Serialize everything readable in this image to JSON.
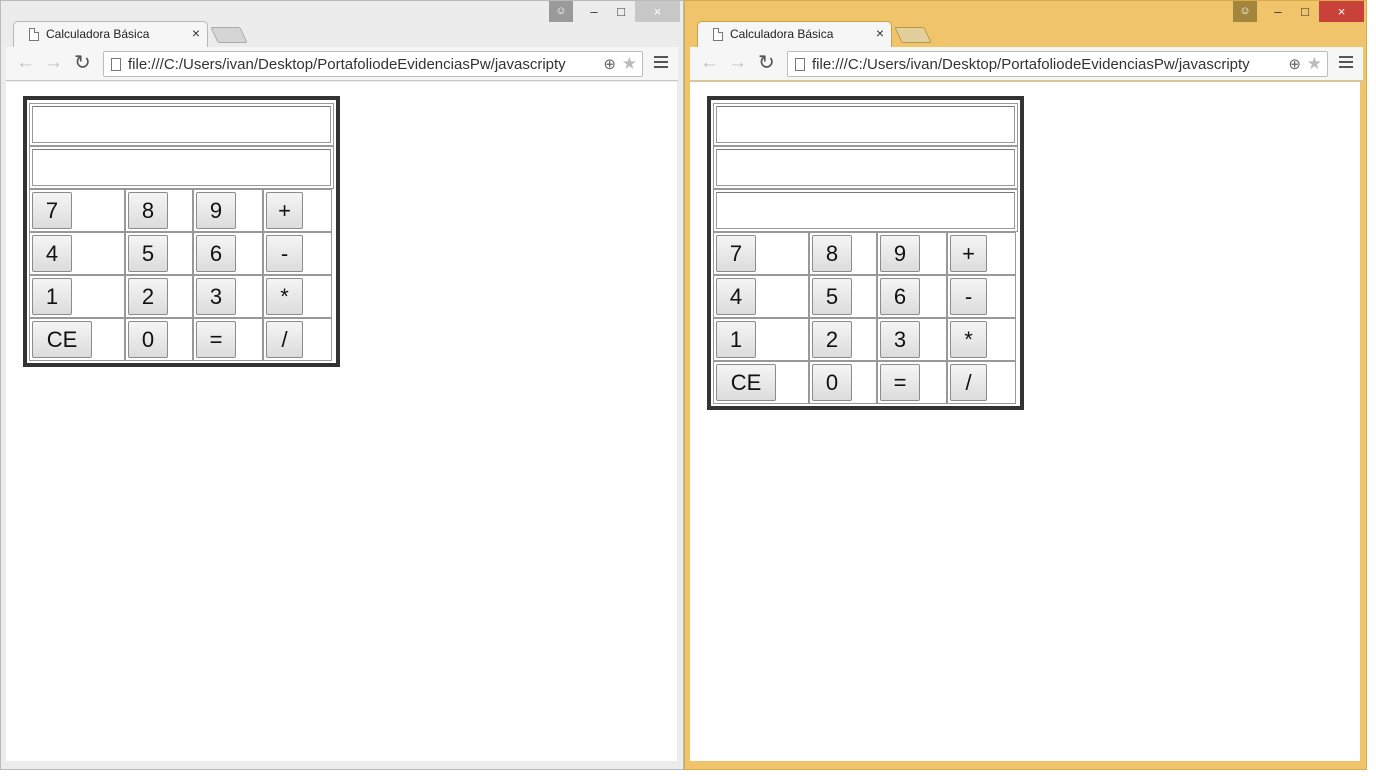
{
  "windows": [
    {
      "tab_title": "Calculadora Básica",
      "tab_close": "×",
      "url": "file:///C:/Users/ivan/Desktop/PortafoliodeEvidenciasPw/javascripty",
      "display_count": 2
    },
    {
      "tab_title": "Calculadora Básica",
      "tab_close": "×",
      "url": "file:///C:/Users/ivan/Desktop/PortafoliodeEvidenciasPw/javascripty",
      "display_count": 3
    }
  ],
  "window_controls": {
    "minimize": "–",
    "maximize": "□",
    "close": "×"
  },
  "keypad": [
    [
      "7",
      "8",
      "9",
      "+"
    ],
    [
      "4",
      "5",
      "6",
      "-"
    ],
    [
      "1",
      "2",
      "3",
      "*"
    ],
    [
      "CE",
      "0",
      "=",
      "/"
    ]
  ],
  "icons": {
    "back": "←",
    "forward": "→",
    "reload": "↻",
    "zoom": "⊕",
    "star": "★",
    "user": "👤"
  },
  "colors": {
    "left_frame": "#ececec",
    "right_frame": "#f0c46a",
    "close_active": "#c8423a"
  }
}
